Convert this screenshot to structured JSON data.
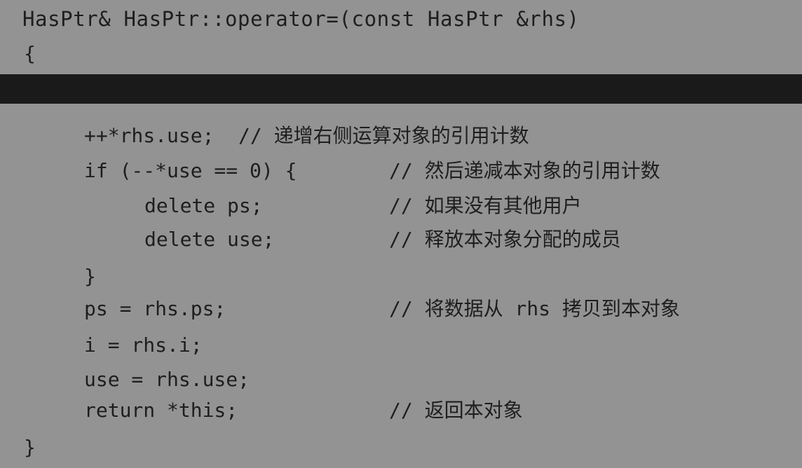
{
  "code": {
    "signature": "HasPtr& HasPtr::operator=(const HasPtr &rhs)",
    "open_brace": "{",
    "lines": [
      {
        "code": "++*rhs.use;",
        "comment": "// 递增右侧运算对象的引用计数"
      },
      {
        "code": "if (--*use == 0) {",
        "comment": "// 然后递减本对象的引用计数"
      },
      {
        "code": "delete ps;",
        "comment": "// 如果没有其他用户"
      },
      {
        "code": "delete use;",
        "comment": "// 释放本对象分配的成员"
      },
      {
        "code": "}",
        "comment": ""
      },
      {
        "code": "ps = rhs.ps;",
        "comment": "// 将数据从 rhs 拷贝到本对象"
      },
      {
        "code": "i = rhs.i;",
        "comment": ""
      },
      {
        "code": "use = rhs.use;",
        "comment": ""
      },
      {
        "code": "return *this;",
        "comment": "// 返回本对象"
      }
    ],
    "close_brace": "}"
  },
  "colors": {
    "background": "#939393",
    "text": "#1e1e1e",
    "band": "#1a1a1a"
  }
}
